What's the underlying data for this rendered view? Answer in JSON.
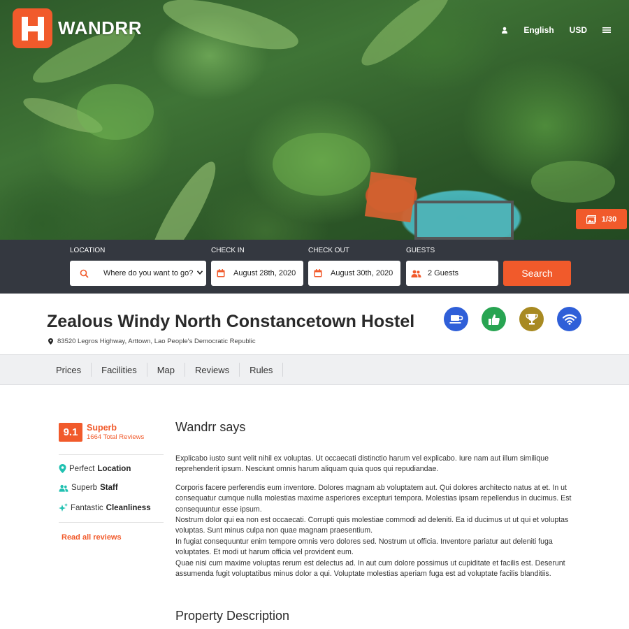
{
  "brand": {
    "logo_letter": "H",
    "name": "WANDRR",
    "accent_color": "#f15a2b",
    "dark_color": "#343840"
  },
  "topnav": {
    "user_icon": "user-icon",
    "language": "English",
    "currency": "USD",
    "menu_icon": "hamburger-menu-icon"
  },
  "gallery": {
    "icon": "images-icon",
    "counter": "1/30"
  },
  "search": {
    "location_label": "LOCATION",
    "location_placeholder": "Where do you want to go?",
    "checkin_label": "CHECK IN",
    "checkin_value": "August 28th, 2020",
    "checkout_label": "CHECK OUT",
    "checkout_value": "August 30th, 2020",
    "guests_label": "GUESTS",
    "guests_value": "2 Guests",
    "button": "Search"
  },
  "property": {
    "name": "Zealous Windy North Constancetown Hostel",
    "address": "83520 Legros Highway, Arttown, Lao People's Democratic Republic",
    "badges": [
      {
        "icon": "coffee-cup-icon",
        "color": "#2f5fd8"
      },
      {
        "icon": "thumbs-up-icon",
        "color": "#28a452"
      },
      {
        "icon": "trophy-icon",
        "color": "#a88a22"
      },
      {
        "icon": "wifi-icon",
        "color": "#2f5fd8"
      }
    ]
  },
  "tabs": [
    "Prices",
    "Facilities",
    "Map",
    "Reviews",
    "Rules"
  ],
  "rating": {
    "score": "9.1",
    "word": "Superb",
    "total": "1664 Total Reviews",
    "features": [
      {
        "prefix": "Perfect",
        "bold": "Location",
        "icon": "map-pin-icon",
        "icon_color": "#21c1b1"
      },
      {
        "prefix": "Superb",
        "bold": "Staff",
        "icon": "users-icon",
        "icon_color": "#21c1b1"
      },
      {
        "prefix": "Fantastic",
        "bold": "Cleanliness",
        "icon": "sparkle-icon",
        "icon_color": "#21c1b1"
      }
    ],
    "read_all": "Read all reviews"
  },
  "main": {
    "says_heading": "Wandrr says",
    "paragraph1": "Explicabo iusto sunt velit nihil ex voluptas. Ut occaecati distinctio harum vel explicabo. Iure nam aut illum similique reprehenderit ipsum. Nesciunt omnis harum aliquam quia quos qui repudiandae.",
    "paragraph2": "Corporis facere perferendis eum inventore. Dolores magnam ab voluptatem aut. Qui dolores architecto natus at et. In ut consequatur cumque nulla molestias maxime asperiores excepturi tempora. Molestias ipsam repellendus in ducimus. Est consequuntur esse ipsum.",
    "paragraph3": "Nostrum dolor qui ea non est occaecati. Corrupti quis molestiae commodi ad deleniti. Ea id ducimus ut ut qui et voluptas voluptas. Sunt minus culpa non quae magnam praesentium.",
    "paragraph4": "In fugiat consequuntur enim tempore omnis vero dolores sed. Nostrum ut officia. Inventore pariatur aut deleniti fuga voluptates. Et modi ut harum officia vel provident eum.",
    "paragraph5": "Quae nisi cum maxime voluptas rerum est delectus ad. In aut cum dolore possimus ut cupiditate et facilis est. Deserunt assumenda fugit voluptatibus minus dolor a qui. Voluptate molestias aperiam fuga est ad voluptate facilis blanditiis.",
    "description_heading": "Property Description"
  }
}
